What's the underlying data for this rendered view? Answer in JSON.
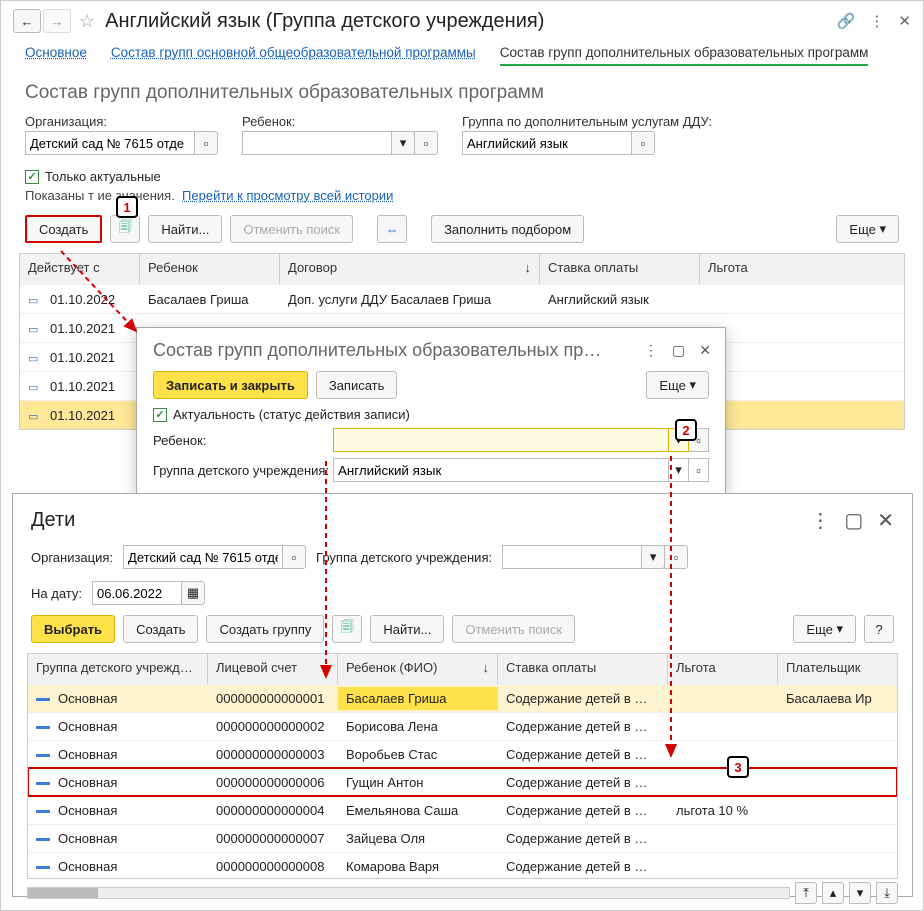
{
  "header": {
    "title": "Английский язык (Группа детского учреждения)"
  },
  "tabs": {
    "main": "Основное",
    "t2": "Состав групп основной общеобразовательной программы",
    "t3": "Состав групп дополнительных образовательных программ"
  },
  "section_title": "Состав групп дополнительных образовательных программ",
  "filters": {
    "org_label": "Организация:",
    "org_value": "Детский сад № 7615 отде",
    "child_label": "Ребенок:",
    "child_value": "",
    "group_label": "Группа по дополнительным услугам ДДУ:",
    "group_value": "Английский язык"
  },
  "chk_actual": "Только актуальные",
  "history_text": "Показаны т        ие значения.",
  "history_link": "Перейти к просмотру всей истории",
  "buttons": {
    "create": "Создать",
    "find": "Найти...",
    "cancel_search": "Отменить поиск",
    "fill": "Заполнить подбором",
    "more": "Еще"
  },
  "grid1": {
    "cols": {
      "c1": "Действует с",
      "c2": "Ребенок",
      "c3": "Договор",
      "c4": "Ставка оплаты",
      "c5": "Льгота"
    },
    "rows": [
      {
        "date": "01.10.2022",
        "child": "Басалаев Гриша",
        "doc": "Доп. услуги ДДУ Басалаев Гриша",
        "rate": "Английский язык",
        "lgota": ""
      },
      {
        "date": "01.10.2021",
        "child": "",
        "doc": "",
        "rate": "",
        "lgota": ""
      },
      {
        "date": "01.10.2021",
        "child": "",
        "doc": "",
        "rate": "",
        "lgota": ""
      },
      {
        "date": "01.10.2021",
        "child": "",
        "doc": "",
        "rate": "",
        "lgota": ""
      },
      {
        "date": "01.10.2021",
        "child": "",
        "doc": "",
        "rate": "",
        "lgota": "",
        "sel": true
      }
    ]
  },
  "callouts": {
    "n1": "1",
    "n2": "2",
    "n3": "3"
  },
  "popup": {
    "title": "Состав групп дополнительных образовательных пр…",
    "save_close": "Записать и закрыть",
    "save": "Записать",
    "more": "Еще",
    "actual": "Актуальность (статус действия записи)",
    "child_lab": "Ребенок:",
    "child_val": "",
    "group_lab": "Группа детского учреждения:",
    "group_val": "Английский язык"
  },
  "children": {
    "title": "Дети",
    "org_label": "Организация:",
    "org_value": "Детский сад № 7615 отде",
    "grp_label": "Группа детского учреждения:",
    "grp_value": "",
    "date_label": "На дату:",
    "date_value": "06.06.2022",
    "btn_select": "Выбрать",
    "btn_create": "Создать",
    "btn_group": "Создать группу",
    "btn_find": "Найти...",
    "btn_cancel": "Отменить поиск",
    "btn_more": "Еще",
    "cols": {
      "c1": "Группа детского учрежд…",
      "c2": "Лицевой счет",
      "c3": "Ребенок (ФИО)",
      "c4": "Ставка оплаты",
      "c5": "Льгота",
      "c6": "Плательщик"
    },
    "rows": [
      {
        "g": "Основная",
        "acc": "000000000000001",
        "name": "Басалаев Гриша",
        "rate": "Содержание детей в …",
        "lg": "",
        "payer": "Басалаева Ир",
        "hl": true,
        "nsel": true
      },
      {
        "g": "Основная",
        "acc": "000000000000002",
        "name": "Борисова Лена",
        "rate": "Содержание детей в …",
        "lg": "",
        "payer": ""
      },
      {
        "g": "Основная",
        "acc": "000000000000003",
        "name": "Воробьев Стас",
        "rate": "Содержание детей в …",
        "lg": "",
        "payer": ""
      },
      {
        "g": "Основная",
        "acc": "000000000000006",
        "name": "Гущин Антон",
        "rate": "Содержание детей в …",
        "lg": "",
        "payer": "",
        "red": true
      },
      {
        "g": "Основная",
        "acc": "000000000000004",
        "name": "Емельянова Саша",
        "rate": "Содержание детей в …",
        "lg": "льгота 10 %",
        "payer": ""
      },
      {
        "g": "Основная",
        "acc": "000000000000007",
        "name": "Зайцева Оля",
        "rate": "Содержание детей в …",
        "lg": "",
        "payer": ""
      },
      {
        "g": "Основная",
        "acc": "000000000000008",
        "name": "Комарова Варя",
        "rate": "Содержание детей в …",
        "lg": "",
        "payer": ""
      }
    ]
  }
}
